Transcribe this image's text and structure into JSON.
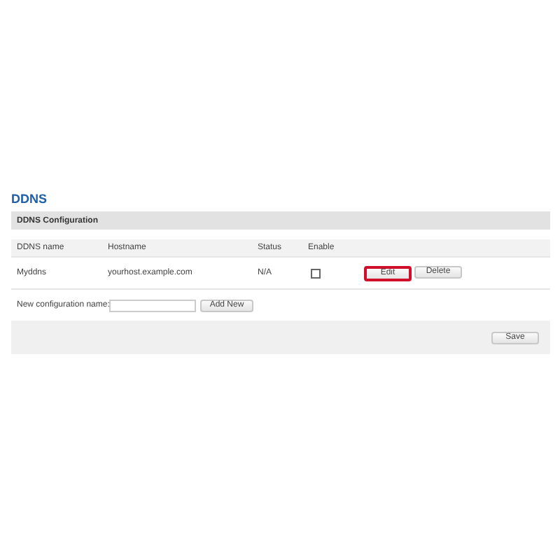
{
  "title": "DDNS",
  "section": {
    "title": "DDNS Configuration"
  },
  "table": {
    "columns": [
      "DDNS name",
      "Hostname",
      "Status",
      "Enable"
    ],
    "rows": [
      {
        "name": "Myddns",
        "hostname": "yourhost.example.com",
        "status": "N/A",
        "enabled": false,
        "buttons": [
          {
            "label": "Edit",
            "highlighted": true
          },
          {
            "label": "Delete",
            "highlighted": false
          }
        ]
      }
    ]
  },
  "new_config": {
    "label": "New configuration name:",
    "button": "Add New"
  },
  "save_button": "Save"
}
